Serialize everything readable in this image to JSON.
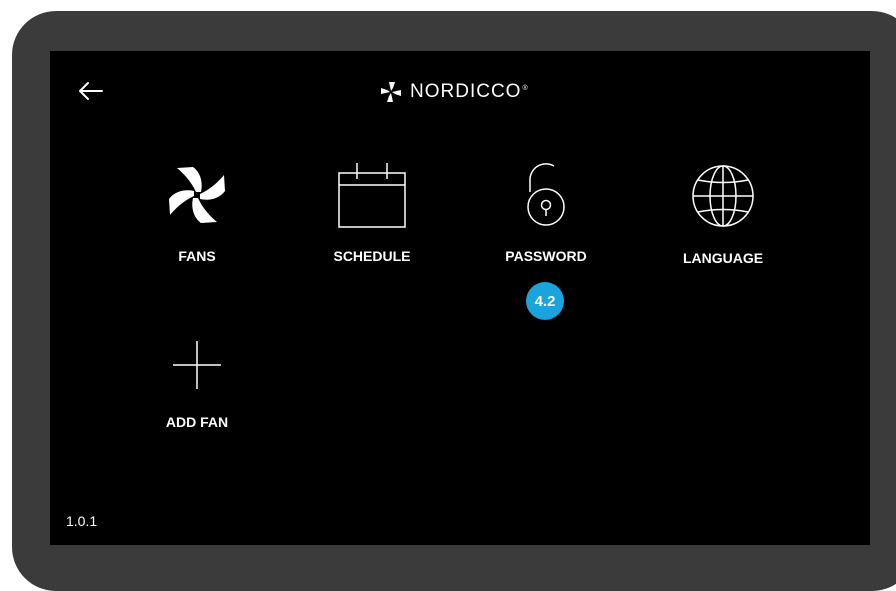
{
  "brand": {
    "name": "NORDICCO",
    "reg_mark": "®"
  },
  "tiles": [
    {
      "label": "FANS",
      "icon": "fan-icon"
    },
    {
      "label": "SCHEDULE",
      "icon": "calendar-icon"
    },
    {
      "label": "PASSWORD",
      "icon": "unlock-icon"
    },
    {
      "label": "LANGUAGE",
      "icon": "globe-icon"
    },
    {
      "label": "ADD FAN",
      "icon": "plus-icon"
    }
  ],
  "annotation_badge": "4.2",
  "version": "1.0.1",
  "colors": {
    "bezel": "#3b3b3b",
    "screen": "#000000",
    "badge": "#1aa3dc"
  }
}
